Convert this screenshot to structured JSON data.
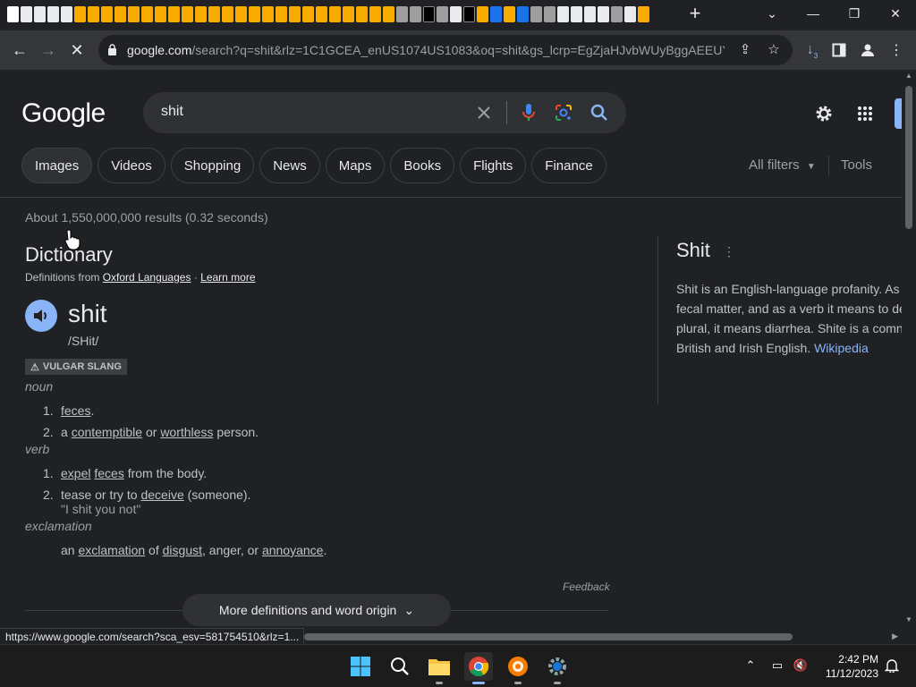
{
  "browser": {
    "new_tab_label": "+",
    "url_host": "google.com",
    "url_path": "/search?q=shit&rlz=1C1GCEA_enUS1074US1083&oq=shit&gs_lcrp=EgZjaHJvbWUyBggAEEUY...",
    "download_badge": "3",
    "status_url": "https://www.google.com/search?sca_esv=581754510&rlz=1..."
  },
  "search": {
    "logo": "Google",
    "query": "shit",
    "chips": [
      "Images",
      "Videos",
      "Shopping",
      "News",
      "Maps",
      "Books",
      "Flights",
      "Finance"
    ],
    "all_filters": "All filters",
    "tools": "Tools",
    "stats": "About 1,550,000,000 results (0.32 seconds)"
  },
  "dictionary": {
    "heading": "Dictionary",
    "source_prefix": "Definitions from",
    "source_link": "Oxford Languages",
    "source_sep": "·",
    "learn_more": "Learn more",
    "word": "shit",
    "phonetic": "/SHit/",
    "register": "VULGAR SLANG",
    "noun": "noun",
    "noun_defs": [
      {
        "num": "1.",
        "parts": [
          {
            "t": "feces",
            "u": true
          },
          {
            "t": ".",
            "u": false
          }
        ]
      },
      {
        "num": "2.",
        "parts": [
          {
            "t": "a ",
            "u": false
          },
          {
            "t": "contemptible",
            "u": true
          },
          {
            "t": " or ",
            "u": false
          },
          {
            "t": "worthless",
            "u": true
          },
          {
            "t": " person.",
            "u": false
          }
        ]
      }
    ],
    "verb": "verb",
    "verb_defs": [
      {
        "num": "1.",
        "parts": [
          {
            "t": "expel",
            "u": true
          },
          {
            "t": " ",
            "u": false
          },
          {
            "t": "feces",
            "u": true
          },
          {
            "t": " from the body.",
            "u": false
          }
        ]
      },
      {
        "num": "2.",
        "parts": [
          {
            "t": "tease or try to ",
            "u": false
          },
          {
            "t": "deceive",
            "u": true
          },
          {
            "t": " (someone).",
            "u": false
          }
        ]
      }
    ],
    "verb_example": "\"I shit you not\"",
    "exclamation": "exclamation",
    "exclamation_def": [
      {
        "t": "an ",
        "u": false
      },
      {
        "t": "exclamation",
        "u": true
      },
      {
        "t": " of ",
        "u": false
      },
      {
        "t": "disgust",
        "u": true
      },
      {
        "t": ", anger, or ",
        "u": false
      },
      {
        "t": "annoyance",
        "u": true
      },
      {
        "t": ".",
        "u": false
      }
    ],
    "feedback": "Feedback",
    "more": "More definitions and word origin"
  },
  "knowledge_panel": {
    "title": "Shit",
    "lines": [
      "Shit is an English-language profanity. As",
      "fecal matter, and as a verb it means to de",
      "plural, it means diarrhea. Shite is a comn",
      "British and Irish English. "
    ],
    "link": "Wikipedia"
  },
  "taskbar": {
    "time": "2:42 PM",
    "date": "11/12/2023"
  },
  "colors": {
    "background": "#202124",
    "link": "#8ab4f8",
    "accent": "#8ab4f8"
  }
}
